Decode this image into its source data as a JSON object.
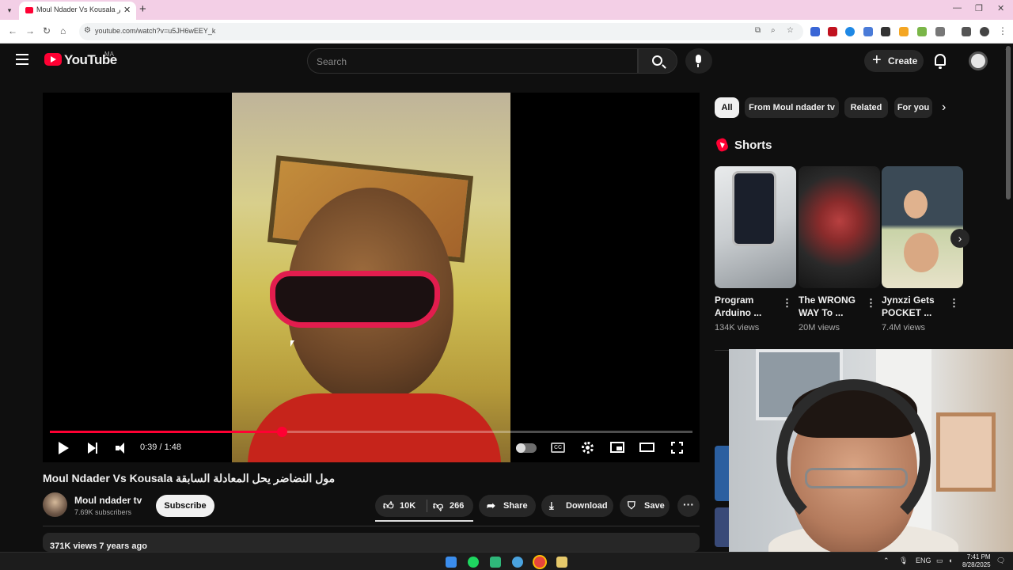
{
  "browser": {
    "tab_title": "Moul Ndader Vs Kousala مول النضاضر",
    "tab_close": "✕",
    "new_tab": "+",
    "url": "youtube.com/watch?v=u5JH6wEEY_k",
    "window_controls": [
      "—",
      "❐",
      "✕"
    ]
  },
  "header": {
    "logo_text": "YouTube",
    "country_code": "MA",
    "search_placeholder": "Search",
    "create_label": "Create"
  },
  "player": {
    "time_display": "0:39 / 1:48",
    "progress_fraction": 0.3611,
    "cc_label": "CC"
  },
  "video": {
    "title": "Moul Ndader Vs Kousala مول النضاضر يحل المعادلة السابقة",
    "channel_name": "Moul ndader tv",
    "subscribers": "7.69K subscribers",
    "subscribe_label": "Subscribe",
    "likes": "10K",
    "dislikes": "266",
    "share_label": "Share",
    "download_label": "Download",
    "save_label": "Save",
    "more_label": "···",
    "description_meta": "371K views  7 years ago"
  },
  "filter_chips": [
    "All",
    "From Moul ndader tv",
    "Related",
    "For you"
  ],
  "shorts": {
    "heading": "Shorts",
    "items": [
      {
        "title": "Program Arduino ...",
        "views": "134K views"
      },
      {
        "title": "The WRONG WAY To ...",
        "views": "20M views"
      },
      {
        "title": "Jynxzi Gets POCKET ...",
        "views": "7.4M views"
      }
    ]
  },
  "taskbar": {
    "language": "ENG",
    "time": "7:41 PM",
    "date": "8/28/2025"
  },
  "colors": {
    "accent": "#ff0033",
    "background": "#0f0f0f",
    "chip_bg": "#272727",
    "tab_strip": "#f3cfe6"
  }
}
